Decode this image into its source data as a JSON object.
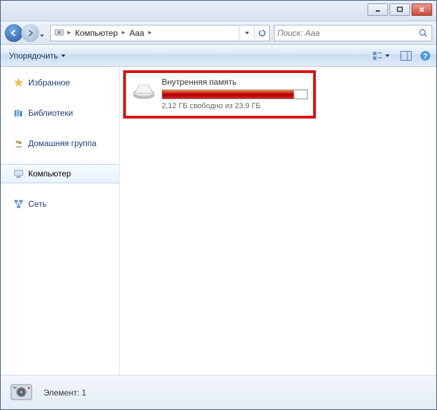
{
  "breadcrumb": {
    "seg1": "Компьютер",
    "seg2": "Aaa"
  },
  "search": {
    "placeholder": "Поиск: Aaa"
  },
  "toolbar": {
    "organize": "Упорядочить"
  },
  "sidebar": {
    "favorites": "Избранное",
    "libraries": "Библиотеки",
    "homegroup": "Домашняя группа",
    "computer": "Компьютер",
    "network": "Сеть"
  },
  "drive": {
    "name": "Внутренняя память",
    "free_text": "2,12 ГБ свободно из 23,9 ГБ",
    "fill_percent": 91
  },
  "status": {
    "items_label": "Элемент: 1"
  }
}
